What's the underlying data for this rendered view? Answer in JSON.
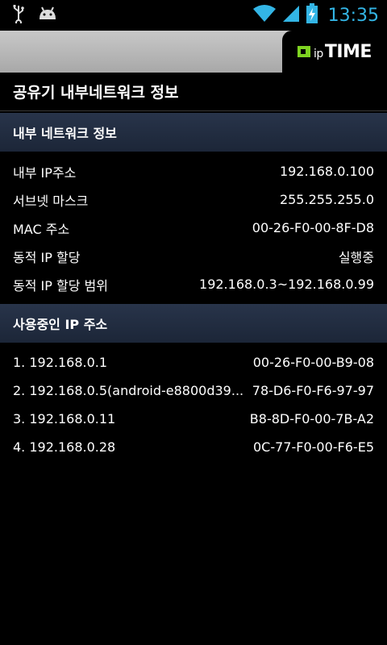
{
  "status_bar": {
    "time": "13:35",
    "icons": [
      "usb-icon",
      "android-icon",
      "wifi-icon",
      "signal-icon",
      "battery-charging-icon"
    ],
    "accent": "#33b5e5"
  },
  "brand": {
    "ip": "ip",
    "name": "TIME",
    "mark_color": "#7ed321"
  },
  "page": {
    "title": "공유기 내부네트워크 정보"
  },
  "internal_network": {
    "header": "내부 네트워크 정보",
    "rows": [
      {
        "label": "내부 IP주소",
        "value": "192.168.0.100"
      },
      {
        "label": "서브넷 마스크",
        "value": "255.255.255.0"
      },
      {
        "label": "MAC 주소",
        "value": "00-26-F0-00-8F-D8"
      },
      {
        "label": "동적 IP 할당",
        "value": "실행중"
      },
      {
        "label": "동적 IP 할당 범위",
        "value": "192.168.0.3~192.168.0.99"
      }
    ]
  },
  "used_ips": {
    "header": "사용중인 IP 주소",
    "rows": [
      {
        "label": "1. 192.168.0.1",
        "value": "00-26-F0-00-B9-08"
      },
      {
        "label": "2. 192.168.0.5(android-e8800d39...",
        "value": "78-D6-F0-F6-97-97"
      },
      {
        "label": "3. 192.168.0.11",
        "value": "B8-8D-F0-00-7B-A2"
      },
      {
        "label": "4. 192.168.0.28",
        "value": "0C-77-F0-00-F6-E5"
      }
    ]
  },
  "colors": {
    "section_bg": "#1c2638",
    "header_band": "#b8b8b8"
  }
}
